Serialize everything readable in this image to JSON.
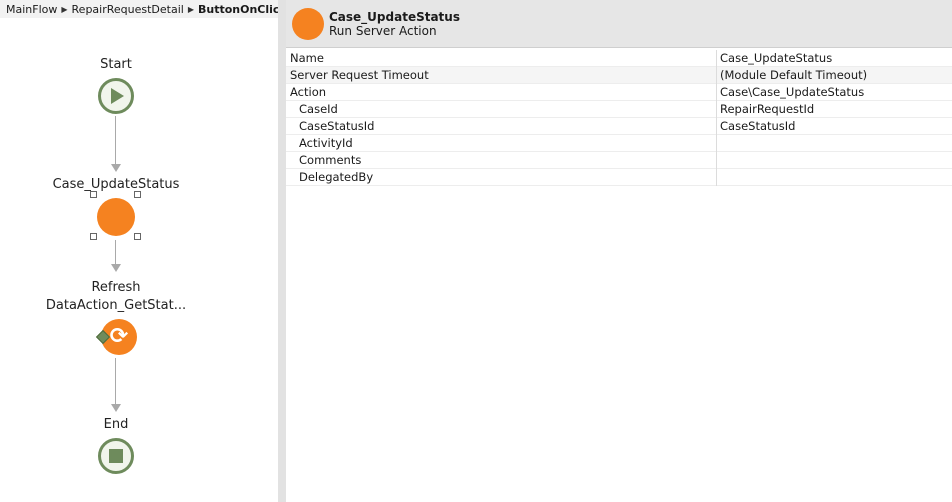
{
  "breadcrumb": {
    "items": [
      "MainFlow",
      "RepairRequestDetail"
    ],
    "current": "ButtonOnClick"
  },
  "flow": {
    "start_label": "Start",
    "action_label": "Case_UpdateStatus",
    "refresh_label_1": "Refresh",
    "refresh_label_2": "DataAction_GetStat...",
    "end_label": "End"
  },
  "properties": {
    "title": "Case_UpdateStatus",
    "subtitle": "Run Server Action",
    "rows": [
      {
        "name": "Name",
        "value": "Case_UpdateStatus"
      },
      {
        "name": "Server Request Timeout",
        "value": "(Module Default Timeout)"
      },
      {
        "name": "Action",
        "value": "Case\\Case_UpdateStatus"
      },
      {
        "name": "CaseId",
        "value": "RepairRequestId"
      },
      {
        "name": "CaseStatusId",
        "value": "CaseStatusId"
      },
      {
        "name": "ActivityId",
        "value": ""
      },
      {
        "name": "Comments",
        "value": ""
      },
      {
        "name": "DelegatedBy",
        "value": ""
      }
    ]
  },
  "colors": {
    "accent_orange": "#f58220",
    "node_green": "#6e8b5c"
  }
}
